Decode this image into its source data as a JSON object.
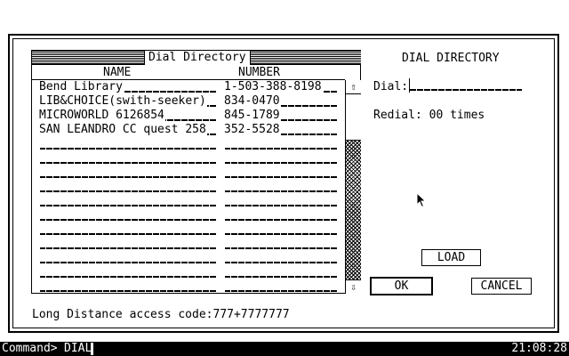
{
  "dialog": {
    "list_title": "Dial Directory",
    "columns": {
      "name": "NAME",
      "number": "NUMBER"
    },
    "entries": [
      {
        "name": "Bend Library",
        "number": "1-503-388-8198"
      },
      {
        "name": "LIB&CHOICE(swith-seeker)",
        "number": "834-0470"
      },
      {
        "name": "MICROWORLD 6126854",
        "number": "845-1789"
      },
      {
        "name": "SAN LEANDRO CC quest 258",
        "number": "352-5528"
      },
      {
        "name": "",
        "number": ""
      },
      {
        "name": "",
        "number": ""
      },
      {
        "name": "",
        "number": ""
      },
      {
        "name": "",
        "number": ""
      },
      {
        "name": "",
        "number": ""
      },
      {
        "name": "",
        "number": ""
      },
      {
        "name": "",
        "number": ""
      },
      {
        "name": "",
        "number": ""
      },
      {
        "name": "",
        "number": ""
      },
      {
        "name": "",
        "number": ""
      },
      {
        "name": "",
        "number": ""
      }
    ],
    "scroll_up_glyph": "⇧",
    "scroll_down_glyph": "⇩",
    "panel_title": "DIAL DIRECTORY",
    "dial_label": "Dial:",
    "dial_value": "",
    "redial_text": "Redial: 00 times",
    "load_label": "LOAD",
    "ok_label": "OK",
    "cancel_label": "CANCEL",
    "long_distance_label": "Long Distance access code:",
    "long_distance_value": "777+7777777"
  },
  "command_bar": {
    "prompt": "Command>",
    "command": "DIAL",
    "clock": "21:08:28"
  }
}
